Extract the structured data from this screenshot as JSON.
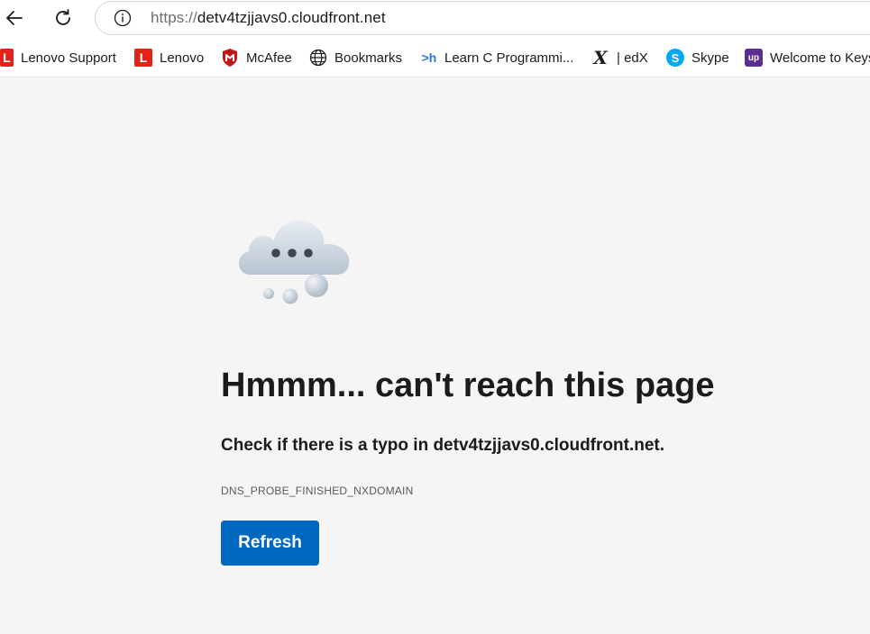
{
  "toolbar": {
    "url_scheme": "https://",
    "url_host": "detv4tzjjavs0.cloudfront.net"
  },
  "bookmarks": [
    {
      "label": "Lenovo Support",
      "icon": "lenovo-icon",
      "icon_text": "L"
    },
    {
      "label": "Lenovo",
      "icon": "lenovo-icon",
      "icon_text": "L"
    },
    {
      "label": "McAfee",
      "icon": "mcafee-icon"
    },
    {
      "label": "Bookmarks",
      "icon": "globe-icon"
    },
    {
      "label": "Learn C Programmi...",
      "icon": "hackerrank-icon",
      "icon_text": ">h"
    },
    {
      "label": "| edX",
      "icon": "edx-icon",
      "icon_text": "X"
    },
    {
      "label": "Skype",
      "icon": "skype-icon",
      "icon_text": "S"
    },
    {
      "label": "Welcome to Keys",
      "icon": "upgrad-icon",
      "icon_text": "up"
    }
  ],
  "error": {
    "headline": "Hmmm... can't reach this page",
    "message": "Check if there is a typo in detv4tzjjavs0.cloudfront.net.",
    "code": "DNS_PROBE_FINISHED_NXDOMAIN",
    "refresh_label": "Refresh"
  },
  "colors": {
    "accent": "#0067c0",
    "page_background": "#f5f5f5",
    "lenovo_red": "#e2231a",
    "skype_blue": "#00a9f0",
    "upgrad_purple": "#5c2d91"
  }
}
